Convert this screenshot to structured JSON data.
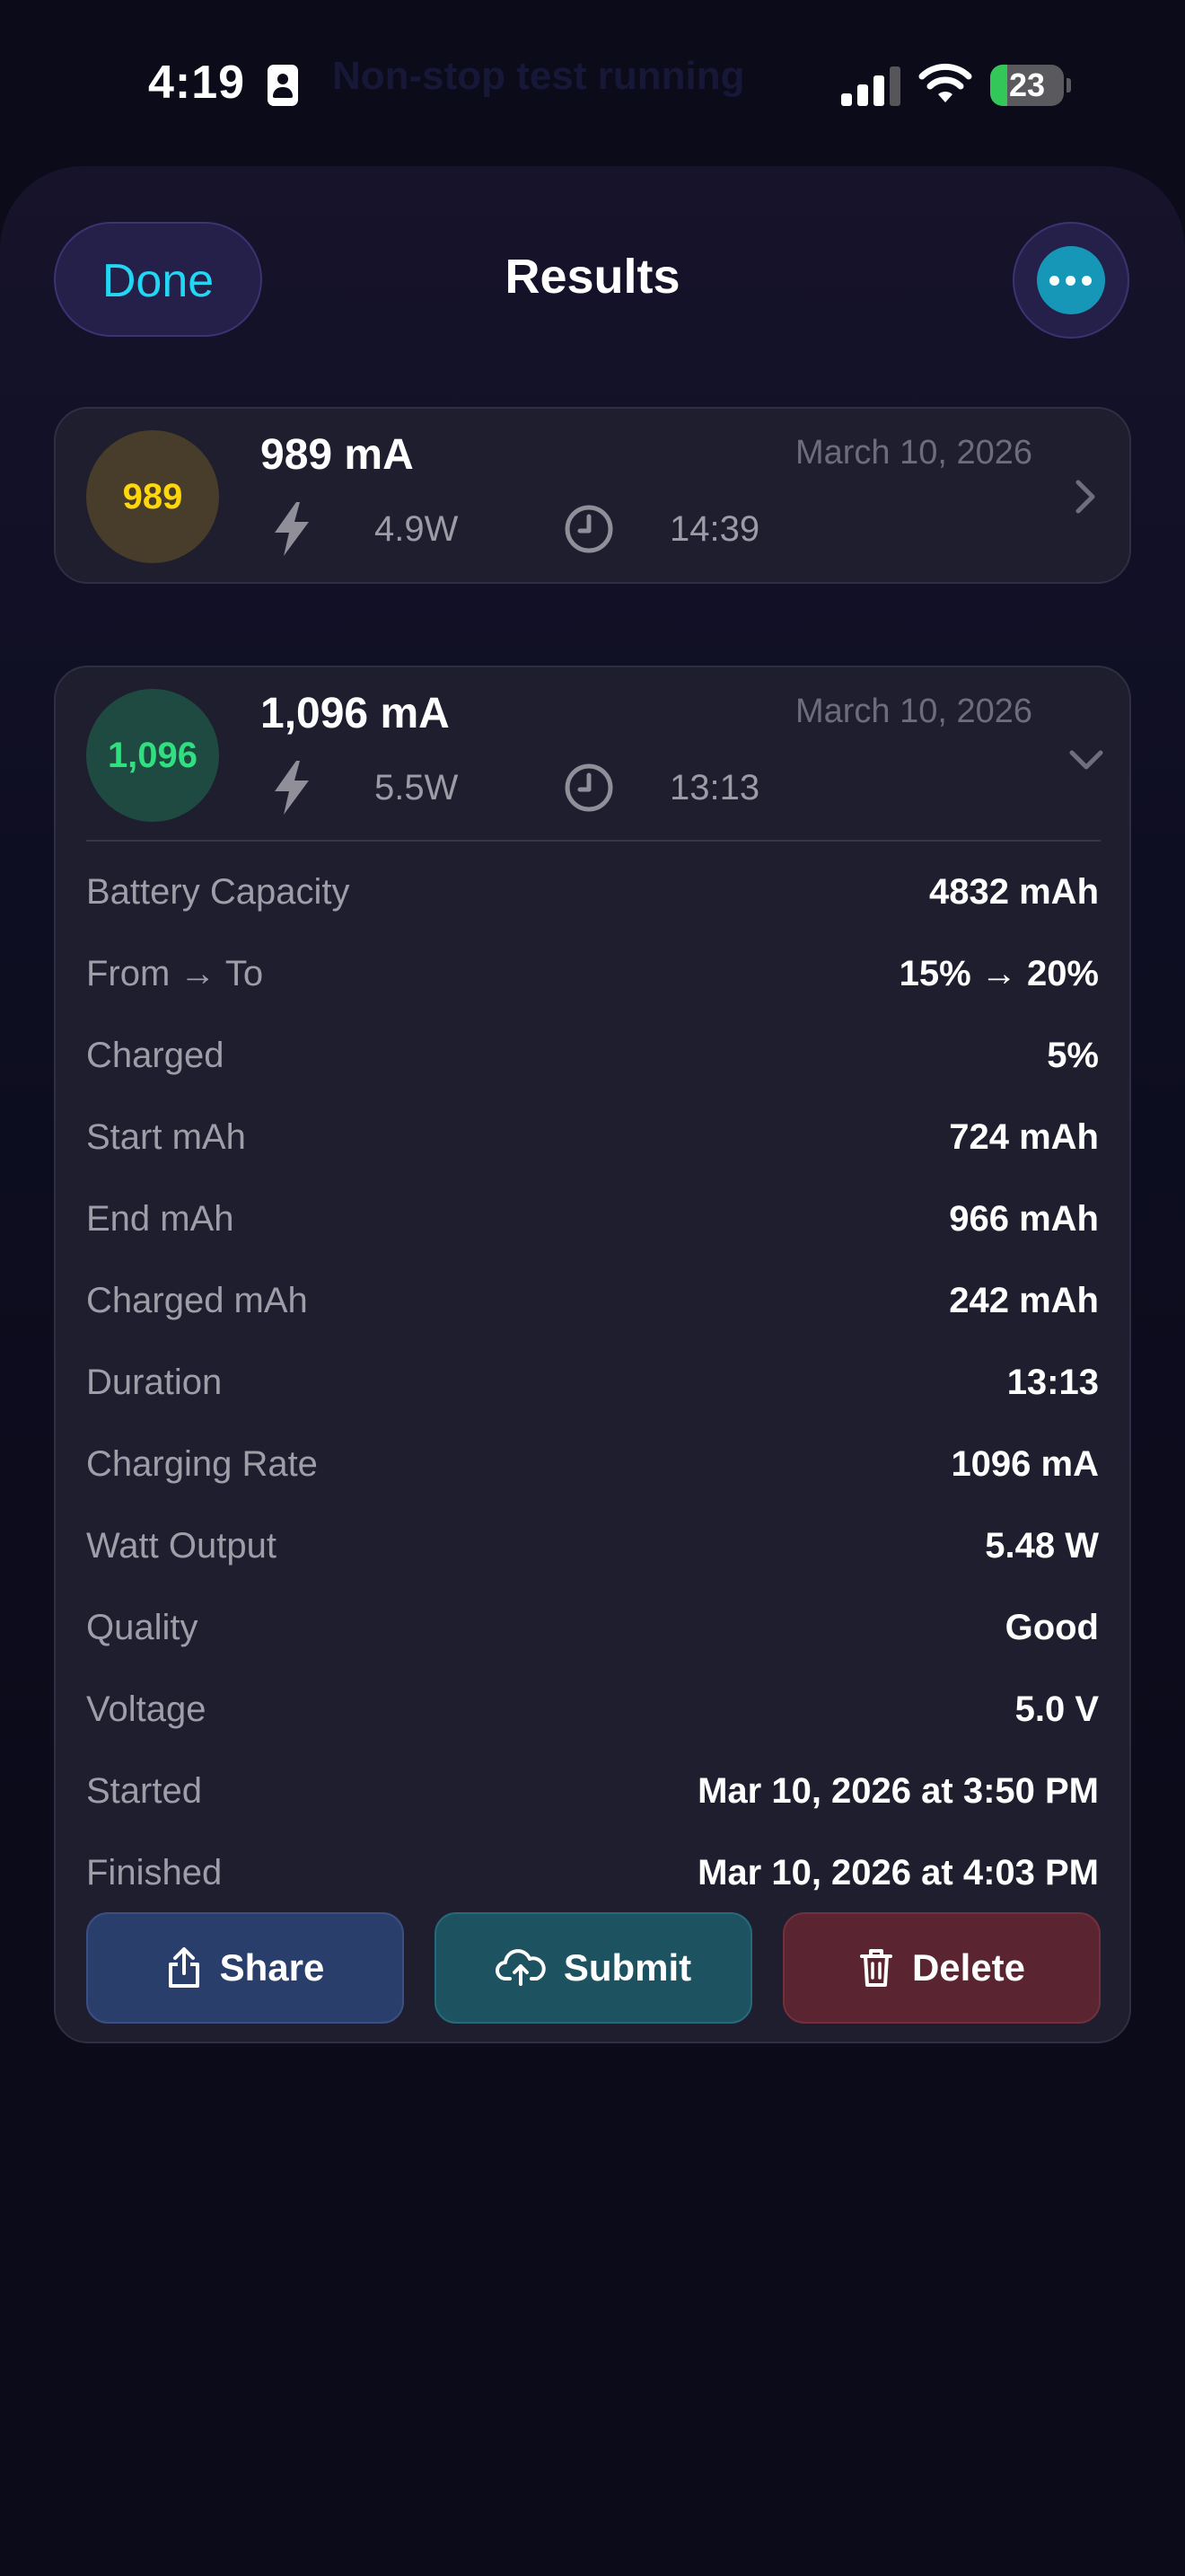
{
  "status_bar": {
    "time": "4:19",
    "notification": "Non-stop test running",
    "battery_level": "23",
    "battery_fraction": 0.23
  },
  "header": {
    "done_label": "Done",
    "title": "Results"
  },
  "results": [
    {
      "badge": "989",
      "title": "989 mA",
      "date": "March 10, 2026",
      "watts": "4.9W",
      "duration": "14:39",
      "badge_color": "#ffd60a"
    },
    {
      "badge": "1,096",
      "title": "1,096 mA",
      "date": "March 10, 2026",
      "watts": "5.5W",
      "duration": "13:13",
      "badge_color": "#30e080",
      "details": [
        {
          "label": "Battery Capacity",
          "value": "4832 mAh"
        },
        {
          "label": "From → To",
          "value": "15% → 20%"
        },
        {
          "label": "Charged",
          "value": "5%"
        },
        {
          "label": "Start mAh",
          "value": "724 mAh"
        },
        {
          "label": "End mAh",
          "value": "966 mAh"
        },
        {
          "label": "Charged mAh",
          "value": "242 mAh"
        },
        {
          "label": "Duration",
          "value": "13:13"
        },
        {
          "label": "Charging Rate",
          "value": "1096 mA"
        },
        {
          "label": "Watt Output",
          "value": "5.48 W"
        },
        {
          "label": "Quality",
          "value": "Good"
        },
        {
          "label": "Voltage",
          "value": "5.0 V"
        },
        {
          "label": "Started",
          "value": "Mar 10, 2026 at 3:50 PM"
        },
        {
          "label": "Finished",
          "value": "Mar 10, 2026 at 4:03 PM"
        }
      ],
      "actions": {
        "share": "Share",
        "submit": "Submit",
        "delete": "Delete"
      }
    }
  ],
  "icons": {
    "bolt": "bolt-icon",
    "clock": "clock-icon",
    "chevron_right": "chevron-right-icon",
    "chevron_down": "chevron-down-icon",
    "more": "ellipsis-icon",
    "share": "share-icon",
    "submit": "cloud-upload-icon",
    "delete": "trash-icon"
  },
  "colors": {
    "accent": "#21d7f4",
    "share_button": "#2a3e6c",
    "submit_button": "#1d5260",
    "delete_button": "#5a2430"
  }
}
